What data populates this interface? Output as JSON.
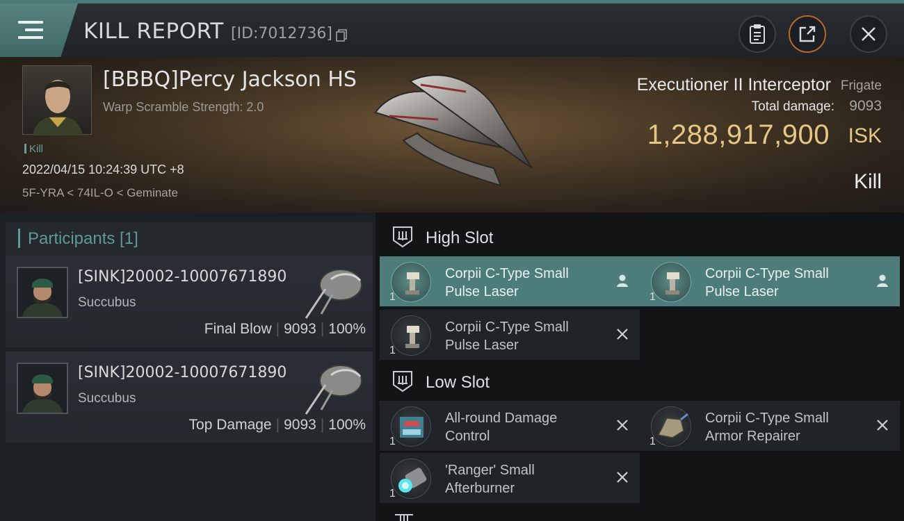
{
  "header": {
    "title": "KILL REPORT",
    "report_id": "[ID:7012736]",
    "icons": [
      "menu-icon",
      "copy-icon",
      "clipboard-icon",
      "share-icon",
      "close-icon"
    ]
  },
  "victim": {
    "name": "[BBBQ]Percy Jackson HS",
    "subtitle": "Warp Scramble Strength: 2.0",
    "tag": "Kill",
    "datetime": "2022/04/15 10:24:39 UTC +8",
    "location": "5F-YRA < 74IL-O < Geminate",
    "ship_name": "Executioner II Interceptor",
    "ship_class": "Frigate",
    "total_damage_label": "Total damage:",
    "total_damage": "9093",
    "isk_value": "1,288,917,900",
    "isk_unit": "ISK",
    "result": "Kill"
  },
  "participants": {
    "header": "Participants [1]",
    "items": [
      {
        "name": "[SINK]20002-10007671890",
        "ship": "Succubus",
        "role": "Final Blow",
        "damage": "9093",
        "percent": "100%"
      },
      {
        "name": "[SINK]20002-10007671890",
        "ship": "Succubus",
        "role": "Top Damage",
        "damage": "9093",
        "percent": "100%"
      }
    ]
  },
  "slots": {
    "high": {
      "title": "High Slot",
      "modules": [
        {
          "name": "Corpii C-Type Small Pulse Laser",
          "qty": "1",
          "status": "person-icon",
          "active": true
        },
        {
          "name": "Corpii C-Type Small Pulse Laser",
          "qty": "1",
          "status": "person-icon",
          "active": true
        },
        {
          "name": "Corpii C-Type Small Pulse Laser",
          "qty": "1",
          "status": "destroyed-x-icon",
          "active": false
        }
      ]
    },
    "low": {
      "title": "Low Slot",
      "modules": [
        {
          "name": "All-round Damage Control",
          "qty": "1",
          "status": "destroyed-x-icon",
          "active": false
        },
        {
          "name": "Corpii C-Type Small Armor Repairer",
          "qty": "1",
          "status": "destroyed-x-icon",
          "active": false
        },
        {
          "name": "'Ranger' Small Afterburner",
          "qty": "1",
          "status": "destroyed-x-icon",
          "active": false
        }
      ]
    }
  },
  "colors": {
    "accent_teal": "#4d7d7a",
    "isk_gold": "#e6c884",
    "background": "#17191c"
  }
}
